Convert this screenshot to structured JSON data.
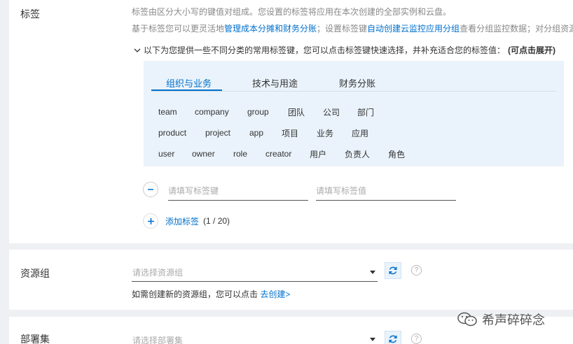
{
  "tags": {
    "label": "标签",
    "desc_line1": "标签由区分大小写的键值对组成。您设置的标签将应用在本次创建的全部实例和云盘。",
    "desc_line2_pre": "基于标签您可以更灵活地",
    "desc_line2_link1": "管理成本分摊和财务分账",
    "desc_line2_mid": "；设置标签键",
    "desc_line2_link2": "自动创建云监控应用分组",
    "desc_line2_post": "查看分组监控数据；对分组资源",
    "hint_text": "以下为您提供一些不同分类的常用标签键，您可以点击标签键快速选择，并补充适合您的标签值：",
    "hint_bold": "(可点击展开)",
    "tabs": [
      "组织与业务",
      "技术与用途",
      "财务分账"
    ],
    "active_tab": "组织与业务",
    "chips_row1": [
      "team",
      "company",
      "group",
      "团队",
      "公司",
      "部门"
    ],
    "chips_row2": [
      "product",
      "project",
      "app",
      "项目",
      "业务",
      "应用"
    ],
    "chips_row3": [
      "user",
      "owner",
      "role",
      "creator",
      "用户",
      "负责人",
      "角色"
    ],
    "key_placeholder": "请填写标签键",
    "value_placeholder": "请填写标签值",
    "add_label": "添加标签",
    "add_count": "(1 / 20)"
  },
  "resource_group": {
    "label": "资源组",
    "placeholder": "请选择资源组",
    "hint_pre": "如需创建新的资源组，您可以点击",
    "hint_link": "去创建>"
  },
  "deployment_set": {
    "label": "部署集",
    "placeholder": "请选择部署集"
  },
  "watermark": {
    "text": "希声碎碎念"
  },
  "colors": {
    "accent": "#0070cc",
    "panel_bg": "#eaf3fb"
  }
}
